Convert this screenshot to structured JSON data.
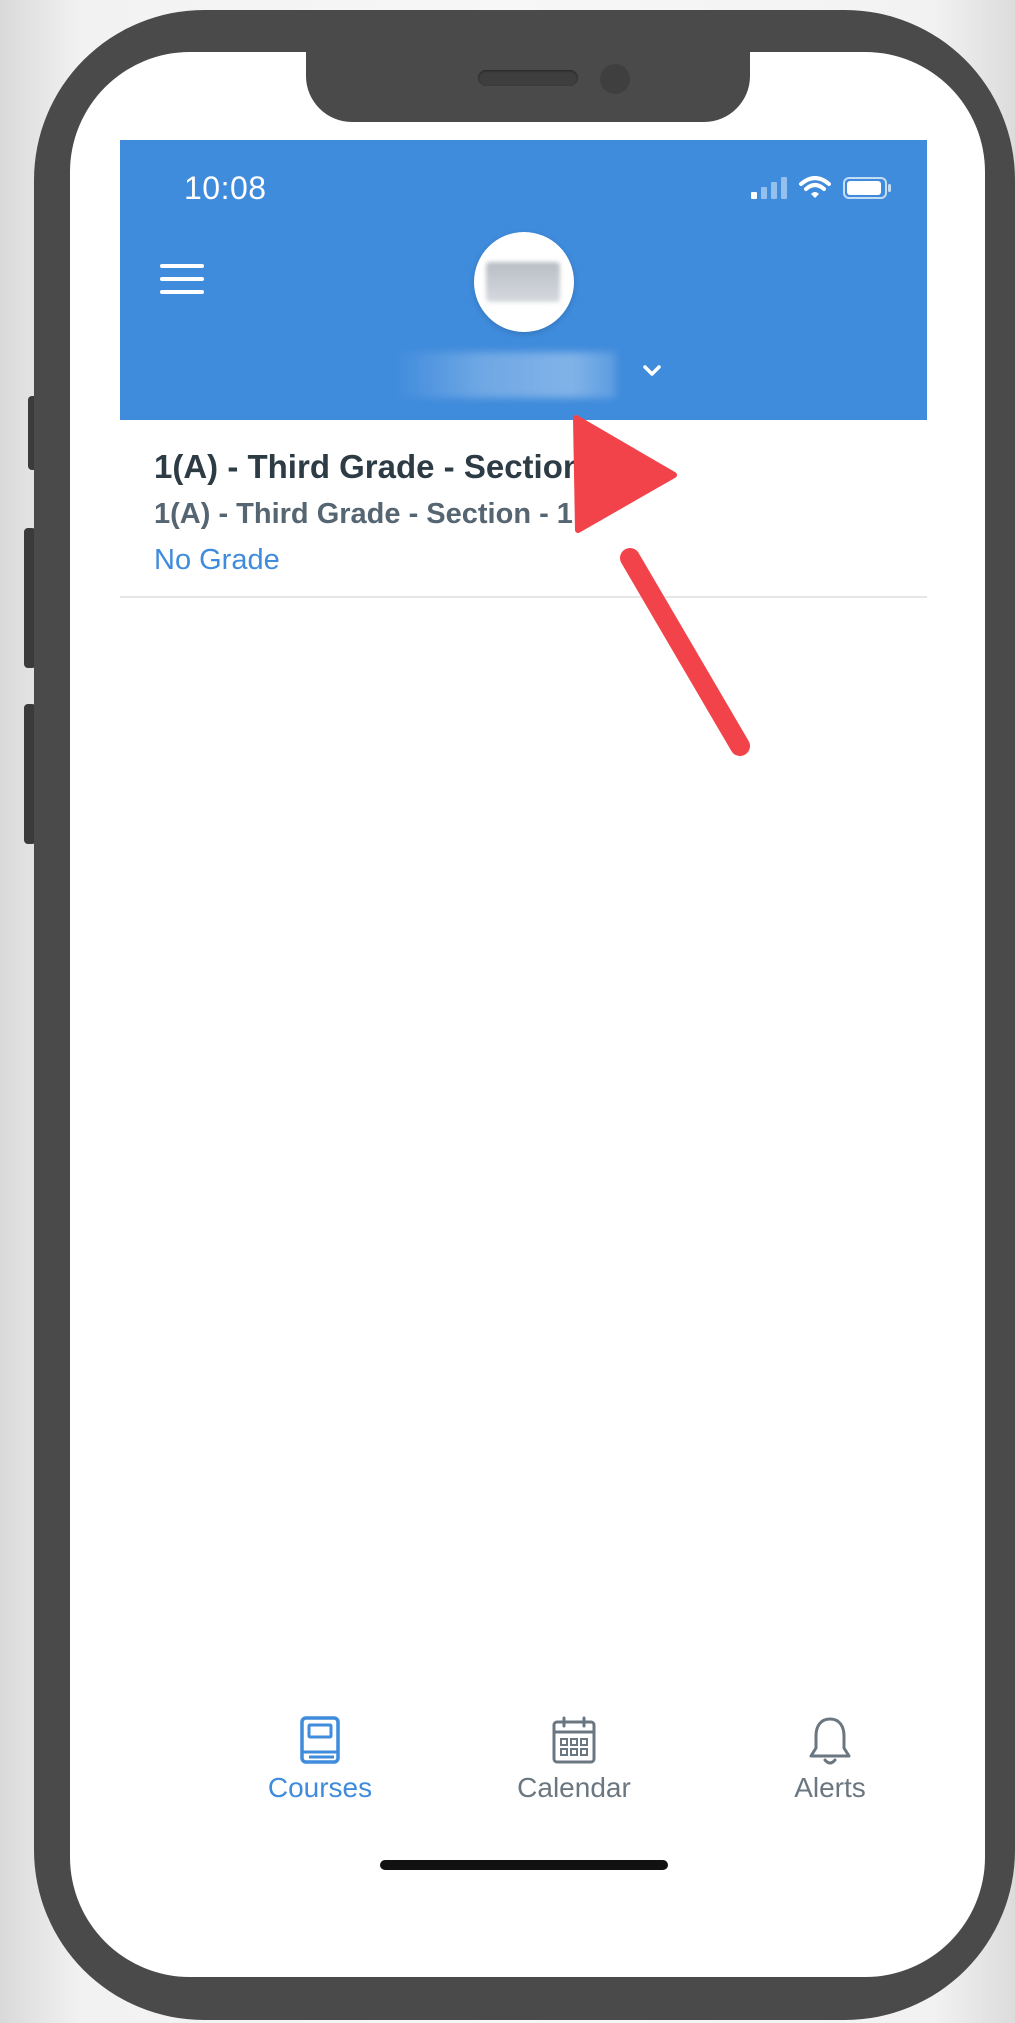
{
  "status_bar": {
    "time": "10:08"
  },
  "header": {
    "background_color": "#3f8bdc"
  },
  "courses": [
    {
      "title": "1(A) - Third Grade - Section - 1",
      "subtitle": "1(A) - Third Grade - Section - 1",
      "grade": "No Grade"
    }
  ],
  "tabbar": {
    "tabs": [
      {
        "label": "Courses",
        "icon": "book-icon",
        "active": true
      },
      {
        "label": "Calendar",
        "icon": "calendar-icon",
        "active": false
      },
      {
        "label": "Alerts",
        "icon": "bell-icon",
        "active": false
      }
    ],
    "active_color": "#3f8bdc",
    "inactive_color": "#6b7780"
  },
  "annotation": {
    "arrow_color": "#f2434a"
  }
}
